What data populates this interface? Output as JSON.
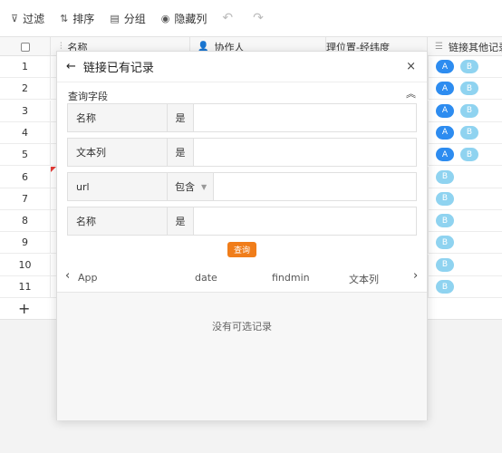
{
  "toolbar": {
    "filter_label": "过滤",
    "sort_label": "排序",
    "group_label": "分组",
    "hide_cols_label": "隐藏列",
    "undo_icon": "undo-icon",
    "redo_icon": "redo-icon"
  },
  "grid": {
    "headers": {
      "name": "名称",
      "collaborator": "协作人",
      "geo": "理位置-经纬度",
      "link": "链接其他记录"
    },
    "rows": [
      "1",
      "2",
      "3",
      "4",
      "5",
      "6",
      "7",
      "8",
      "9",
      "10",
      "11"
    ],
    "row_pills": [
      [
        "A",
        "B"
      ],
      [
        "A",
        "B"
      ],
      [
        "A",
        "B"
      ],
      [
        "A",
        "B"
      ],
      [
        "A",
        "B"
      ],
      [
        "B"
      ],
      [
        "B"
      ],
      [
        "B"
      ],
      [
        "B"
      ],
      [
        "B"
      ],
      [
        "B"
      ]
    ],
    "add_row": "+"
  },
  "dialog": {
    "title": "链接已有记录",
    "close": "×",
    "back": "←",
    "section_title": "查询字段",
    "filters": [
      {
        "field": "名称",
        "op": "是",
        "value": ""
      },
      {
        "field": "文本列",
        "op": "是",
        "value": ""
      },
      {
        "field": "url",
        "op": "包含",
        "value": ""
      },
      {
        "field": "名称",
        "op": "是",
        "value": ""
      }
    ],
    "query_button": "查询",
    "columns": [
      "App",
      "date",
      "findmin",
      "文本列"
    ],
    "empty_text": "没有可选记录"
  },
  "colors": {
    "accent": "#f07d1a",
    "pill_a": "#2d8cf0",
    "pill_b": "#8fd3f0",
    "red_mark": "#e53935"
  }
}
